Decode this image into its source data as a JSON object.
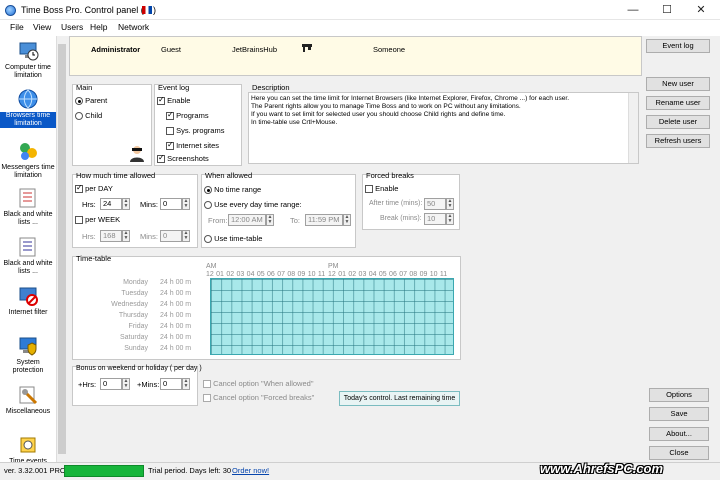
{
  "window": {
    "title": "Time Boss Pro. Control panel (",
    "controls": {
      "minimize": "—",
      "maximize": "☐",
      "close": "✕"
    }
  },
  "menu": [
    "File",
    "View",
    "Users",
    "Help",
    "Network"
  ],
  "sidebar": [
    {
      "label": "Computer time limitation",
      "icon": "computer-clock-icon"
    },
    {
      "label": "Browsers time limitation",
      "icon": "browser-globe-icon",
      "active": true
    },
    {
      "label": "Messengers time limitation",
      "icon": "messenger-icon"
    },
    {
      "label": "Black and white lists ...",
      "icon": "list-icon"
    },
    {
      "label": "Black and white lists ...",
      "icon": "list-icon"
    },
    {
      "label": "Internet filter",
      "icon": "filter-icon"
    },
    {
      "label": "System protection",
      "icon": "shield-icon"
    },
    {
      "label": "Miscellaneous",
      "icon": "tools-icon"
    },
    {
      "label": "Time events",
      "icon": "events-icon"
    }
  ],
  "users": [
    "Administrator",
    "Guest",
    "JetBrainsHub",
    "",
    "Someone"
  ],
  "right_buttons": {
    "event_log": "Event log",
    "new_user": "New user",
    "rename_user": "Rename user",
    "delete_user": "Delete user",
    "refresh_users": "Refresh users",
    "options": "Options",
    "save": "Save",
    "about": "About...",
    "close": "Close"
  },
  "main_panel": {
    "title": "Main",
    "parent": "Parent",
    "child": "Child"
  },
  "event_log": {
    "title": "Event log",
    "enable": "Enable",
    "programs": "Programs",
    "sys_programs": "Sys. programs",
    "internet_sites": "Internet sites",
    "screenshots": "Screenshots"
  },
  "description": {
    "title": "Description",
    "lines": [
      "Here you can set the time limit for Internet Browsers (like Internet Explorer, Firefox, Chrome ...) for each user.",
      "The Parent rights allow you to manage Time Boss and to work on PC without any limitations.",
      "If you want to set limit for selected user you should choose Child rights and define time.",
      "In time-table use Crtl+Mouse."
    ]
  },
  "time_allowed": {
    "title": "How much time allowed",
    "per_day": "per DAY",
    "hrs": "Hrs:",
    "mins": "Mins:",
    "day_hrs": "24",
    "day_mins": "0",
    "per_week": "per WEEK",
    "week_hrs": "168",
    "week_mins": "0"
  },
  "when_allowed": {
    "title": "When allowed",
    "no_time_range": "No time range",
    "every_day": "Use every day time range:",
    "from": "From:",
    "from_val": "12:00 AM",
    "to": "To:",
    "to_val": "11:59 PM",
    "use_timetable": "Use time-table"
  },
  "forced_breaks": {
    "title": "Forced breaks",
    "enable": "Enable",
    "after_time": "After time (mins):",
    "after_val": "50",
    "break": "Break (mins):",
    "break_val": "10"
  },
  "timetable": {
    "title": "Time-table",
    "am": "AM",
    "pm": "PM",
    "hours": [
      "12",
      "01",
      "02",
      "03",
      "04",
      "05",
      "06",
      "07",
      "08",
      "09",
      "10",
      "11",
      "12",
      "01",
      "02",
      "03",
      "04",
      "05",
      "06",
      "07",
      "08",
      "09",
      "10",
      "11"
    ],
    "days": [
      "Monday",
      "Tuesday",
      "Wednesday",
      "Thursday",
      "Friday",
      "Saturday",
      "Sunday"
    ],
    "day_value": "24 h 00 m"
  },
  "bonus": {
    "title": "Bonus on weekend or holiday ( per day )",
    "hrs": "+Hrs:",
    "hrs_val": "0",
    "mins": "+Mins:",
    "mins_val": "0",
    "cancel_when": "Cancel option \"When allowed\"",
    "cancel_forced": "Cancel option \"Forced breaks\""
  },
  "todays_control": "Today's control. Last remaining time",
  "status": {
    "version": "ver. 3.32.001 PRO",
    "trial": "Trial period. Days left: 30",
    "order": "Order now!"
  },
  "watermark": "www.AhrefsPC.com",
  "colors": {
    "accent": "#0a58c7",
    "timetable": "#a8e8ea",
    "progress": "#17b53b",
    "user_strip": "#fffbe6"
  }
}
